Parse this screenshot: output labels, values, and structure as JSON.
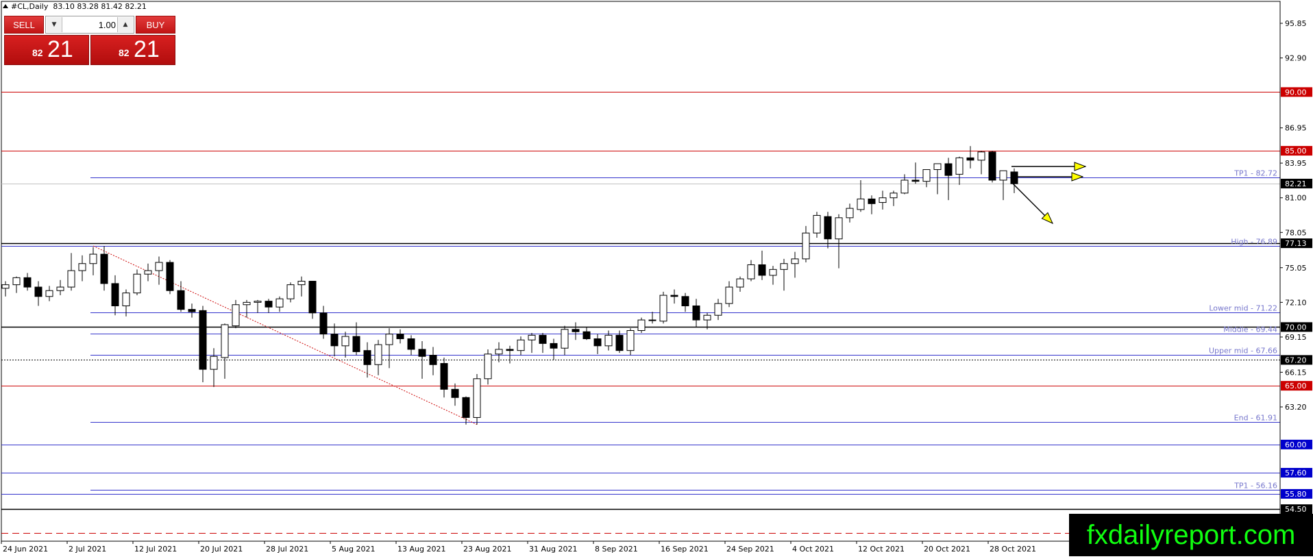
{
  "header": {
    "symbol": "#CL,Daily",
    "ohlc": "83.10 83.28 81.42 82.21"
  },
  "trade_panel": {
    "sell_label": "SELL",
    "buy_label": "BUY",
    "lot_value": "1.00",
    "sell_price_small": "82",
    "sell_price_big": "21",
    "buy_price_small": "82",
    "buy_price_big": "21"
  },
  "watermark": "fxdailyreport.com",
  "chart_data": {
    "type": "candlestick",
    "symbol": "#CL",
    "timeframe": "Daily",
    "current_price": 82.21,
    "colors": {
      "up_body": "#ffffff",
      "down_body": "#000000",
      "wick": "#000000",
      "red_level": "#cc0000",
      "blue_level": "#3333cc",
      "price_box": "#0000cc",
      "arrow_fill": "#ffff00"
    },
    "y_axis": {
      "min": 51.7,
      "max": 97.9,
      "ticks": [
        "95.85",
        "92.90",
        "86.95",
        "83.95",
        "81.00",
        "78.05",
        "75.05",
        "72.10",
        "69.15",
        "66.15",
        "63.20"
      ]
    },
    "x_axis": {
      "labels": [
        "24 Jun 2021",
        "2 Jul 2021",
        "12 Jul 2021",
        "20 Jul 2021",
        "28 Jul 2021",
        "5 Aug 2021",
        "13 Aug 2021",
        "23 Aug 2021",
        "31 Aug 2021",
        "8 Sep 2021",
        "16 Sep 2021",
        "24 Sep 2021",
        "4 Oct 2021",
        "12 Oct 2021",
        "20 Oct 2021",
        "28 Oct 2021"
      ]
    },
    "candles": [
      [
        73.3,
        73.9,
        72.6,
        73.6
      ],
      [
        73.6,
        74.3,
        72.9,
        74.2
      ],
      [
        74.2,
        74.6,
        73.1,
        73.4
      ],
      [
        73.4,
        73.9,
        71.8,
        72.6
      ],
      [
        72.6,
        73.5,
        72.2,
        73.1
      ],
      [
        73.1,
        74.0,
        72.7,
        73.4
      ],
      [
        73.4,
        76.3,
        73.1,
        74.8
      ],
      [
        74.8,
        76.1,
        73.9,
        75.4
      ],
      [
        75.4,
        76.8,
        74.4,
        76.2
      ],
      [
        76.2,
        76.9,
        73.1,
        73.7
      ],
      [
        73.7,
        74.4,
        71.0,
        71.8
      ],
      [
        71.8,
        73.2,
        70.9,
        72.9
      ],
      [
        72.9,
        74.9,
        72.7,
        74.5
      ],
      [
        74.5,
        75.4,
        73.9,
        74.8
      ],
      [
        74.8,
        76.0,
        73.6,
        75.5
      ],
      [
        75.5,
        75.7,
        72.8,
        73.1
      ],
      [
        73.1,
        73.9,
        71.3,
        71.5
      ],
      [
        71.5,
        72.0,
        70.8,
        71.3
      ],
      [
        71.4,
        71.8,
        65.3,
        66.4
      ],
      [
        66.4,
        68.2,
        64.9,
        67.5
      ],
      [
        67.4,
        70.3,
        65.6,
        70.2
      ],
      [
        70.1,
        72.3,
        69.9,
        71.9
      ],
      [
        71.9,
        72.3,
        70.8,
        72.1
      ],
      [
        72.1,
        72.3,
        71.2,
        72.2
      ],
      [
        72.2,
        72.4,
        71.2,
        71.7
      ],
      [
        71.7,
        72.6,
        71.3,
        72.4
      ],
      [
        72.4,
        73.8,
        72.1,
        73.6
      ],
      [
        73.6,
        74.3,
        72.6,
        73.9
      ],
      [
        73.9,
        73.9,
        70.7,
        71.2
      ],
      [
        71.2,
        71.8,
        69.0,
        69.4
      ],
      [
        69.4,
        70.3,
        67.5,
        68.4
      ],
      [
        68.4,
        69.6,
        67.4,
        69.2
      ],
      [
        69.2,
        70.4,
        67.6,
        67.9
      ],
      [
        68.0,
        68.7,
        65.7,
        66.8
      ],
      [
        66.8,
        68.9,
        65.9,
        68.5
      ],
      [
        68.5,
        69.9,
        66.5,
        69.4
      ],
      [
        69.4,
        69.8,
        68.6,
        69.0
      ],
      [
        69.0,
        69.3,
        67.6,
        68.1
      ],
      [
        68.1,
        68.8,
        65.6,
        67.5
      ],
      [
        67.6,
        68.3,
        65.9,
        66.8
      ],
      [
        66.9,
        67.4,
        64.0,
        64.7
      ],
      [
        64.7,
        65.2,
        63.3,
        64.0
      ],
      [
        64.0,
        64.1,
        61.7,
        62.3
      ],
      [
        62.3,
        66.0,
        61.7,
        65.6
      ],
      [
        65.6,
        68.1,
        65.1,
        67.7
      ],
      [
        67.7,
        68.7,
        67.0,
        68.1
      ],
      [
        68.1,
        68.4,
        66.9,
        68.0
      ],
      [
        68.0,
        69.2,
        67.6,
        68.9
      ],
      [
        68.9,
        69.5,
        67.8,
        69.3
      ],
      [
        69.3,
        69.5,
        67.8,
        68.6
      ],
      [
        68.6,
        69.0,
        67.2,
        68.2
      ],
      [
        68.2,
        70.1,
        67.6,
        69.8
      ],
      [
        69.8,
        70.4,
        68.9,
        69.6
      ],
      [
        69.6,
        70.0,
        68.9,
        69.0
      ],
      [
        69.0,
        69.4,
        67.7,
        68.4
      ],
      [
        68.4,
        69.7,
        68.0,
        69.3
      ],
      [
        69.3,
        69.7,
        67.8,
        68.0
      ],
      [
        68.0,
        69.9,
        67.6,
        69.7
      ],
      [
        69.7,
        70.8,
        69.5,
        70.6
      ],
      [
        70.6,
        71.3,
        70.3,
        70.6
      ],
      [
        70.5,
        73.0,
        70.3,
        72.7
      ],
      [
        72.7,
        73.2,
        72.0,
        72.6
      ],
      [
        72.6,
        72.9,
        71.3,
        71.8
      ],
      [
        71.8,
        72.4,
        70.0,
        70.6
      ],
      [
        70.6,
        71.2,
        69.8,
        71.0
      ],
      [
        71.0,
        72.4,
        70.6,
        72.0
      ],
      [
        72.0,
        73.9,
        71.7,
        73.4
      ],
      [
        73.4,
        74.3,
        73.0,
        74.1
      ],
      [
        74.1,
        75.7,
        73.9,
        75.3
      ],
      [
        75.3,
        76.5,
        74.0,
        74.4
      ],
      [
        74.4,
        75.2,
        73.6,
        74.9
      ],
      [
        74.9,
        75.8,
        73.1,
        75.4
      ],
      [
        75.4,
        76.4,
        74.2,
        75.8
      ],
      [
        75.8,
        78.6,
        75.5,
        78.0
      ],
      [
        78.0,
        79.8,
        77.6,
        79.5
      ],
      [
        79.4,
        79.8,
        76.7,
        77.5
      ],
      [
        77.5,
        79.6,
        75.0,
        79.3
      ],
      [
        79.3,
        80.5,
        78.9,
        80.1
      ],
      [
        80.0,
        82.5,
        79.8,
        80.9
      ],
      [
        80.9,
        81.2,
        79.6,
        80.5
      ],
      [
        80.6,
        81.6,
        80.0,
        81.0
      ],
      [
        81.0,
        81.6,
        80.3,
        81.4
      ],
      [
        81.4,
        83.0,
        81.3,
        82.5
      ],
      [
        82.5,
        84.0,
        82.2,
        82.4
      ],
      [
        82.4,
        82.9,
        81.9,
        83.4
      ],
      [
        83.4,
        83.9,
        81.3,
        83.9
      ],
      [
        83.9,
        84.4,
        80.8,
        82.9
      ],
      [
        83.0,
        84.5,
        82.1,
        84.4
      ],
      [
        84.4,
        85.4,
        83.5,
        84.2
      ],
      [
        84.2,
        85.0,
        83.0,
        84.9
      ],
      [
        84.9,
        85.0,
        82.3,
        82.5
      ],
      [
        82.5,
        83.3,
        80.8,
        83.3
      ],
      [
        83.2,
        83.5,
        81.4,
        82.2
      ]
    ],
    "horizontal_levels": [
      {
        "price": 90.0,
        "color": "red",
        "label": "90.00"
      },
      {
        "price": 85.0,
        "color": "red",
        "label": "85.00"
      },
      {
        "price": 82.72,
        "color": "blue",
        "label": "TP1 - 82.72"
      },
      {
        "price": 82.21,
        "color": "gray",
        "label": "82.21"
      },
      {
        "price": 77.13,
        "color": "black",
        "label": "77.13"
      },
      {
        "price": 76.89,
        "color": "blue",
        "label": "High - 76.89"
      },
      {
        "price": 71.22,
        "color": "blue",
        "label": "Lower mid - 71.22"
      },
      {
        "price": 70.0,
        "color": "black",
        "label": "70.00"
      },
      {
        "price": 69.44,
        "color": "blue",
        "label": "Middle - 69.44"
      },
      {
        "price": 67.66,
        "color": "blue",
        "label": "Upper mid - 67.66"
      },
      {
        "price": 67.2,
        "color": "black-dotted",
        "label": "67.20"
      },
      {
        "price": 65.0,
        "color": "red",
        "label": "65.00"
      },
      {
        "price": 61.91,
        "color": "blue",
        "label": "End - 61.91"
      },
      {
        "price": 60.0,
        "color": "blue",
        "label": "60.00"
      },
      {
        "price": 57.6,
        "color": "blue",
        "label": "57.60"
      },
      {
        "price": 56.16,
        "color": "blue",
        "label": "TP1 - 56.16"
      },
      {
        "price": 55.8,
        "color": "blue",
        "label": "55.80"
      },
      {
        "price": 54.5,
        "color": "black",
        "label": "54.50"
      },
      {
        "price": 52.5,
        "color": "red-dashed",
        "label": ""
      }
    ],
    "trendline": {
      "from_candle": 8,
      "from_price": 76.9,
      "to_candle": 43,
      "to_price": 61.7,
      "color": "red",
      "style": "dotted"
    },
    "arrows": [
      "right",
      "right",
      "down-right"
    ]
  }
}
